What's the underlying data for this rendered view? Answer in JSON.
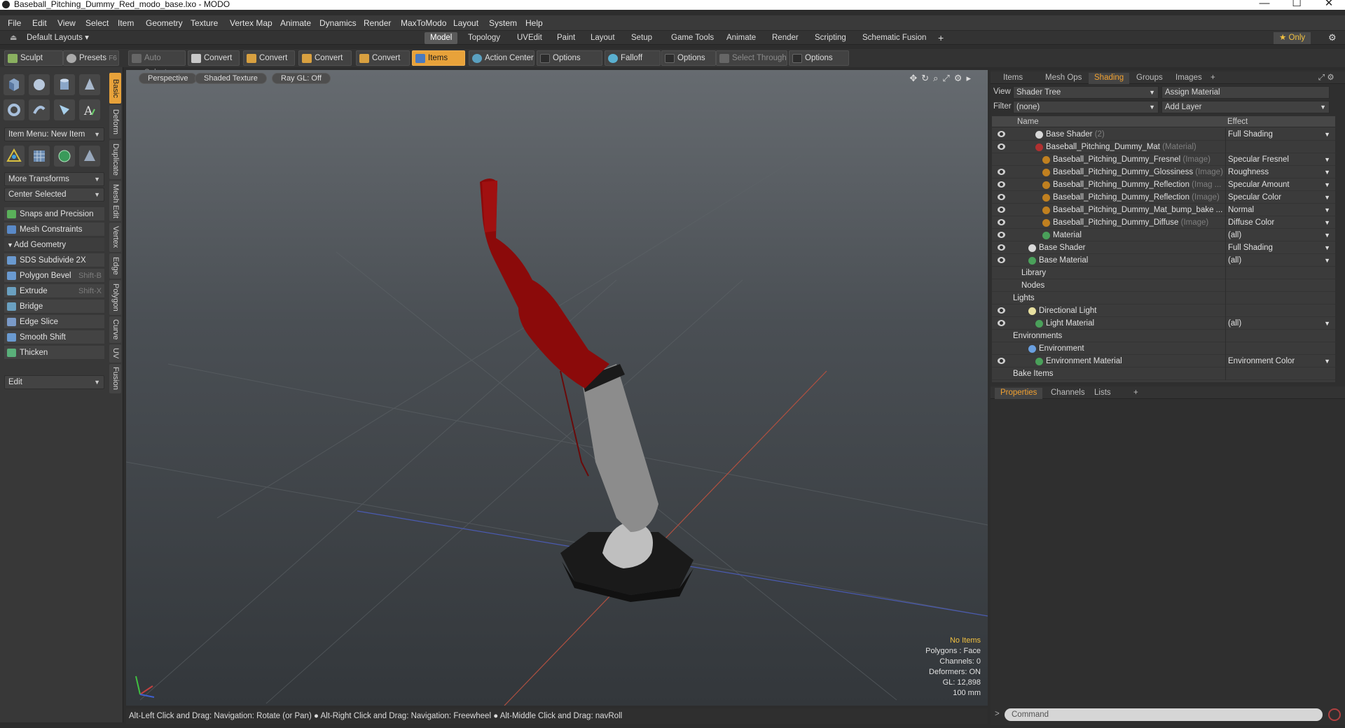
{
  "window": {
    "title": "Baseball_Pitching_Dummy_Red_modo_base.lxo - MODO",
    "min": "—",
    "max": "☐",
    "close": "✕"
  },
  "menu": [
    "File",
    "Edit",
    "View",
    "Select",
    "Item",
    "Geometry",
    "Texture",
    "Vertex Map",
    "Animate",
    "Dynamics",
    "Render",
    "MaxToModo",
    "Layout",
    "System",
    "Help"
  ],
  "layoutbar": {
    "layouts_label": "Default Layouts ▾",
    "tabs": [
      "Model",
      "Topology",
      "UVEdit",
      "Paint",
      "Layout",
      "Setup",
      "Game Tools",
      "Animate",
      "Render",
      "Scripting",
      "Schematic Fusion"
    ],
    "active_tab": "Model",
    "add": "+",
    "only": "★  Only"
  },
  "toolbar": {
    "sculpt": "Sculpt",
    "presets": "Presets",
    "presets_key": "F6",
    "auto_select": "Auto Select",
    "convert1": "Convert",
    "convert2": "Convert",
    "convert3": "Convert",
    "convert4": "Convert",
    "items": "Items",
    "action_center": "Action Center",
    "options1": "Options",
    "falloff": "Falloff",
    "options2": "Options",
    "select_through": "Select Through",
    "options3": "Options"
  },
  "left": {
    "item_menu": "Item Menu: New Item",
    "more_transforms": "More Transforms",
    "center_selected": "Center Selected",
    "snaps": "Snaps and Precision",
    "mesh_constraints": "Mesh Constraints",
    "add_geometry": "Add Geometry",
    "tools": [
      {
        "label": "SDS Subdivide 2X",
        "key": ""
      },
      {
        "label": "Polygon Bevel",
        "key": "Shift-B"
      },
      {
        "label": "Extrude",
        "key": "Shift-X"
      },
      {
        "label": "Bridge",
        "key": ""
      },
      {
        "label": "Edge Slice",
        "key": ""
      },
      {
        "label": "Smooth Shift",
        "key": ""
      },
      {
        "label": "Thicken",
        "key": ""
      }
    ],
    "edit": "Edit",
    "vtabs": [
      "Basic",
      "Deform",
      "Duplicate",
      "Mesh Edit",
      "Vertex",
      "Edge",
      "Polygon",
      "Curve",
      "UV",
      "Fusion"
    ]
  },
  "viewport": {
    "perspective": "Perspective",
    "shading": "Shaded Texture",
    "raygl": "Ray GL: Off",
    "stats": {
      "items": "No Items",
      "polygons": "Polygons : Face",
      "channels": "Channels: 0",
      "deformers": "Deformers: ON",
      "gl": "GL: 12,898",
      "scale": "100 mm"
    }
  },
  "status": "Alt-Left Click and Drag: Navigation: Rotate (or Pan) ● Alt-Right Click and Drag: Navigation: Freewheel ● Alt-Middle Click and Drag: navRoll",
  "right": {
    "tabs": [
      "Items",
      "Mesh Ops",
      "Shading",
      "Groups",
      "Images"
    ],
    "active_tab": "Shading",
    "view_label": "View",
    "view_value": "Shader Tree",
    "assign_material": "Assign Material",
    "filter_label": "Filter",
    "filter_value": "(none)",
    "add_layer": "Add Layer",
    "col_name": "Name",
    "col_effect": "Effect",
    "rows": [
      {
        "name": "Base Shader",
        "type": "(2)",
        "effect": "Full Shading",
        "indent": 1,
        "eye": true,
        "ball": "#d8d8d8"
      },
      {
        "name": "Baseball_Pitching_Dummy_Mat",
        "type": "(Material)",
        "effect": "",
        "indent": 1,
        "eye": true,
        "ball": "#b03030"
      },
      {
        "name": "Baseball_Pitching_Dummy_Fresnel",
        "type": "(Image)",
        "effect": "Specular Fresnel",
        "indent": 2,
        "eye": false,
        "ball": "#c08020"
      },
      {
        "name": "Baseball_Pitching_Dummy_Glossiness",
        "type": "(Image)",
        "effect": "Roughness",
        "indent": 2,
        "eye": true,
        "ball": "#c08020"
      },
      {
        "name": "Baseball_Pitching_Dummy_Reflection",
        "type": "(Imag ...",
        "effect": "Specular Amount",
        "indent": 2,
        "eye": true,
        "ball": "#c08020"
      },
      {
        "name": "Baseball_Pitching_Dummy_Reflection",
        "type": "(Image)",
        "effect": "Specular Color",
        "indent": 2,
        "eye": true,
        "ball": "#c08020"
      },
      {
        "name": "Baseball_Pitching_Dummy_Mat_bump_bake ...",
        "type": "",
        "effect": "Normal",
        "indent": 2,
        "eye": true,
        "ball": "#c08020"
      },
      {
        "name": "Baseball_Pitching_Dummy_Diffuse",
        "type": "(Image)",
        "effect": "Diffuse Color",
        "indent": 2,
        "eye": true,
        "ball": "#c08020"
      },
      {
        "name": "Material",
        "type": "",
        "effect": "(all)",
        "indent": 2,
        "eye": true,
        "ball": "#4aa05a"
      },
      {
        "name": "Base Shader",
        "type": "",
        "effect": "Full Shading",
        "indent": 0,
        "eye": true,
        "ball": "#d8d8d8"
      },
      {
        "name": "Base Material",
        "type": "",
        "effect": "(all)",
        "indent": 0,
        "eye": true,
        "ball": "#4aa05a"
      },
      {
        "name": "Library",
        "type": "",
        "effect": "",
        "indent": -1,
        "eye": false,
        "ball": ""
      },
      {
        "name": "Nodes",
        "type": "",
        "effect": "",
        "indent": -1,
        "eye": false,
        "ball": ""
      },
      {
        "name": "Lights",
        "type": "",
        "effect": "",
        "indent": -2,
        "eye": false,
        "ball": ""
      },
      {
        "name": "Directional Light",
        "type": "",
        "effect": "",
        "indent": 0,
        "eye": true,
        "ball": "#e8e0a0"
      },
      {
        "name": "Light Material",
        "type": "",
        "effect": "(all)",
        "indent": 1,
        "eye": true,
        "ball": "#4aa05a"
      },
      {
        "name": "Environments",
        "type": "",
        "effect": "",
        "indent": -2,
        "eye": false,
        "ball": ""
      },
      {
        "name": "Environment",
        "type": "",
        "effect": "",
        "indent": 0,
        "eye": false,
        "ball": "#6aa0e0"
      },
      {
        "name": "Environment Material",
        "type": "",
        "effect": "Environment Color",
        "indent": 1,
        "eye": true,
        "ball": "#4aa05a"
      },
      {
        "name": "Bake Items",
        "type": "",
        "effect": "",
        "indent": -2,
        "eye": false,
        "ball": ""
      }
    ],
    "props_tabs": [
      "Properties",
      "Channels",
      "Lists"
    ],
    "props_active": "Properties",
    "command_placeholder": "Command"
  }
}
